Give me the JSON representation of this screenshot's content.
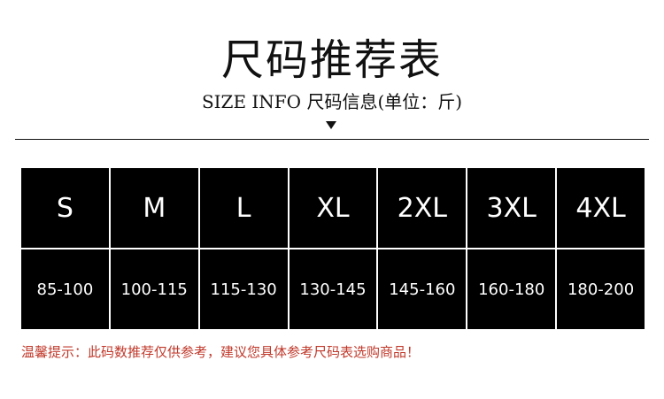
{
  "title": "尺码推荐表",
  "subtitle": "SIZE INFO 尺码信息(单位：斤)",
  "sizes": [
    "S",
    "M",
    "L",
    "XL",
    "2XL",
    "3XL",
    "4XL"
  ],
  "ranges": [
    "85-100",
    "100-115",
    "115-130",
    "130-145",
    "145-160",
    "160-180",
    "180-200"
  ],
  "note": "温馨提示：此码数推荐仅供参考，建议您具体参考尺码表选购商品！",
  "colors": {
    "cell_bg": "#000000",
    "cell_text": "#ffffff",
    "note": "#c0392b"
  }
}
